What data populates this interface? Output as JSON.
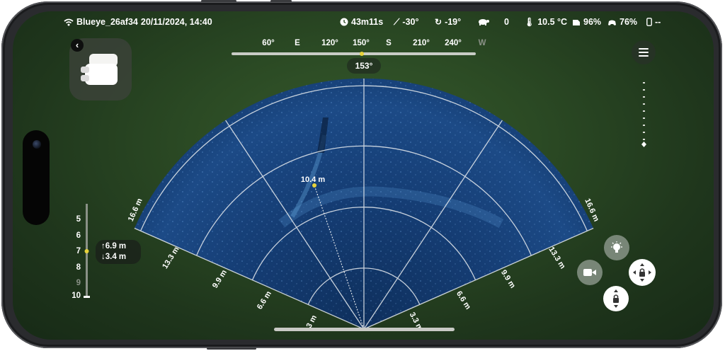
{
  "status": {
    "device": "Blueye_26af34",
    "datetime": "20/11/2024, 14:40",
    "dive_time": "43m11s",
    "pitch": "-30°",
    "roll": "-19°",
    "speed": "0",
    "water_temp": "10.5 °C",
    "drone_battery": "96%",
    "controller_battery": "76%",
    "phone_battery": "--"
  },
  "compass": {
    "labels": [
      "60°",
      "E",
      "120°",
      "150°",
      "S",
      "210°",
      "240°",
      "W"
    ],
    "heading": "153°"
  },
  "depth": {
    "scale": [
      "5",
      "6",
      "7",
      "8",
      "9",
      "10"
    ],
    "current": "7",
    "above": "↑6.9 m",
    "below": "↓3.4 m"
  },
  "sonar": {
    "range_labels_left": [
      "16.6 m",
      "13.3 m",
      "9.9 m",
      "6.6 m",
      "3 m"
    ],
    "range_labels_right": [
      "16.6 m",
      "13.3 m",
      "9.9 m",
      "6.6 m",
      "3.3 m"
    ],
    "measure_label": "10.4 m"
  },
  "icons": {
    "wifi": "wifi-icon",
    "clock": "clock-icon",
    "pitch": "pitch-icon",
    "roll": "roll-icon",
    "speed": "turtle-icon",
    "temperature": "thermometer-icon",
    "drone_battery": "drone-battery-icon",
    "controller_battery": "controller-battery-icon",
    "phone": "phone-icon"
  },
  "colors": {
    "accent": "#e7d23a",
    "text": "#ffffff"
  }
}
